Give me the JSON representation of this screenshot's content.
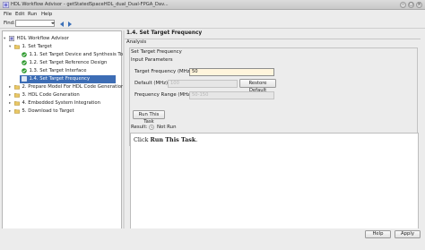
{
  "window": {
    "title": "HDL Workflow Advisor - getStatedSpaceHDL_dual_Dual-FPGA_Dav..."
  },
  "menu": {
    "file": "File",
    "edit": "Edit",
    "run": "Run",
    "help": "Help"
  },
  "toolbar": {
    "find_label": "Find:",
    "find_value": ""
  },
  "tree": {
    "root": "HDL Workflow Advisor",
    "items": [
      {
        "label": "1. Set Target",
        "icon": "folder-icon",
        "expander": "▾"
      },
      {
        "label": "1.1. Set Target Device and Synthesis Too",
        "icon": "check-icon"
      },
      {
        "label": "1.2. Set Target Reference Design",
        "icon": "check-icon"
      },
      {
        "label": "1.3. Set Target Interface",
        "icon": "check-icon"
      },
      {
        "label": "1.4. Set Target Frequency",
        "icon": "task-icon",
        "selected": true
      },
      {
        "label": "2. Prepare Model For HDL Code Generation",
        "icon": "folder-icon",
        "expander": "▸"
      },
      {
        "label": "3. HDL Code Generation",
        "icon": "folder-icon",
        "expander": "▸"
      },
      {
        "label": "4. Embedded System Integration",
        "icon": "folder-icon",
        "expander": "▸"
      },
      {
        "label": "5. Download to Target",
        "icon": "folder-icon",
        "expander": "▸"
      }
    ]
  },
  "main": {
    "step_title": "1.4. Set Target Frequency",
    "analysis_label": "Analysis",
    "group_title": "Set Target Frequency",
    "input_params_label": "Input Parameters",
    "target_freq_label": "Target Frequency (MHz):",
    "target_freq_value": "50",
    "default_label": "Default (MHz):",
    "default_value": "100",
    "restore_default_button": "Restore Default",
    "freq_range_label": "Frequency Range (MHz):",
    "freq_range_value": "50-150",
    "run_button": "Run This Task",
    "result_label": "Result:",
    "result_status": "Not Run",
    "result_text_prefix": "Click ",
    "result_text_bold": "Run This Task",
    "result_text_suffix": "."
  },
  "footer": {
    "help_button": "Help",
    "apply_button": "Apply"
  },
  "colors": {
    "selection": "#3d6db5",
    "check": "#2e9a2e",
    "active_field": "#fff5dc"
  }
}
